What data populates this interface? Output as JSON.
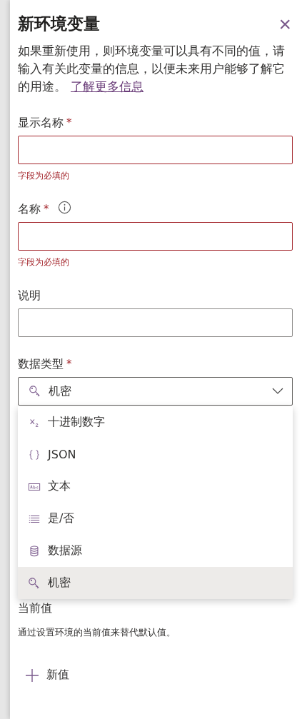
{
  "panel": {
    "title": "新环境变量",
    "close": "×",
    "description": "如果重新使用，则环境变量可以具有不同的值，请输入有关此变量的信息，以便未来用户能够了解它的用途。",
    "link": "了解更多信息"
  },
  "fields": [
    {
      "label": "显示名称",
      "required": "*",
      "info": false,
      "error": "字段为必填的"
    },
    {
      "label": "名称",
      "required": "*",
      "info": true,
      "error": "字段为必填的"
    },
    {
      "label": "说明",
      "info": false
    }
  ],
  "data_type": {
    "label": "数据类型",
    "required": "*",
    "value": "机密",
    "expanded": true,
    "options": [
      {
        "kind": "decimal",
        "label": "十进制数字",
        "selected": false
      },
      {
        "kind": "json",
        "label": "JSON",
        "selected": false
      },
      {
        "kind": "text",
        "label": "文本",
        "selected": false
      },
      {
        "kind": "boolean",
        "label": "是/否",
        "selected": false
      },
      {
        "kind": "datasource",
        "label": "数据源",
        "selected": false
      },
      {
        "kind": "secret",
        "label": "机密",
        "selected": true
      }
    ]
  },
  "current_value": {
    "title": "当前值",
    "description": "通过设置环境的当前值来替代默认值。",
    "add_button": "新值"
  }
}
